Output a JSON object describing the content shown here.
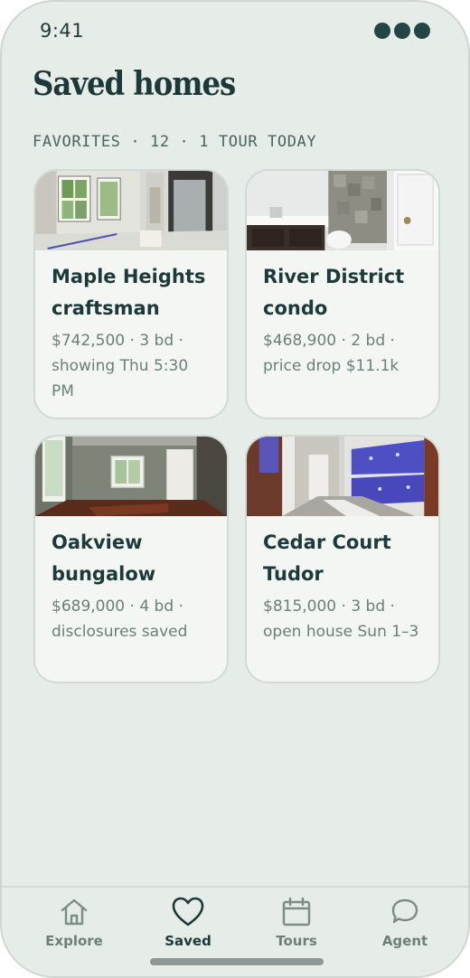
{
  "status_bar": {
    "time": "9:41"
  },
  "header": {
    "title": "Saved homes",
    "subtitle": "FAVORITES · 12 · 1 TOUR TODAY"
  },
  "listings": [
    {
      "title": "Maple Heights craftsman",
      "meta": "$742,500 · 3 bd · showing Thu 5:30 PM"
    },
    {
      "title": "River District condo",
      "meta": "$468,900 · 2 bd · price drop $11.1k"
    },
    {
      "title": "Oakview bungalow",
      "meta": "$689,000 · 4 bd · disclosures saved"
    },
    {
      "title": "Cedar Court Tudor",
      "meta": "$815,000 · 3 bd · open house Sun 1–3"
    }
  ],
  "tab_bar": {
    "tabs": [
      {
        "label": "Explore",
        "icon": "home-icon",
        "active": false
      },
      {
        "label": "Saved",
        "icon": "heart-icon",
        "active": true
      },
      {
        "label": "Tours",
        "icon": "calendar-icon",
        "active": false
      },
      {
        "label": "Agent",
        "icon": "chat-bubble-icon",
        "active": false
      }
    ]
  },
  "colors": {
    "background": "#e6ece7",
    "card": "#f3f6f2",
    "text_primary": "#1c3a3a",
    "text_secondary": "#6b7f7b"
  }
}
